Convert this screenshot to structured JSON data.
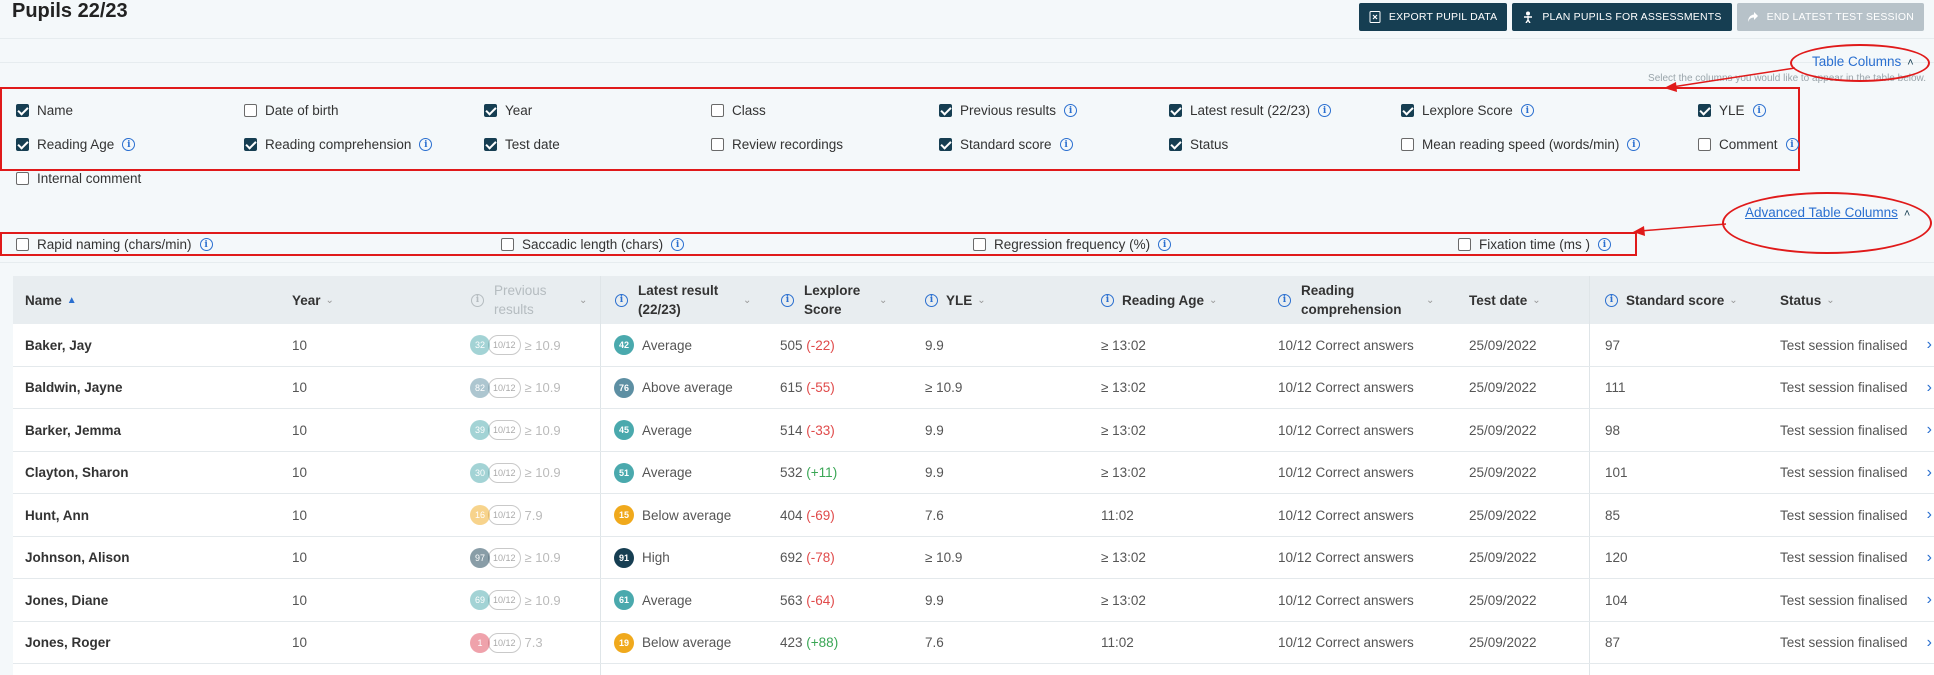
{
  "page": {
    "title": "Pupils 22/23"
  },
  "toolbar": {
    "export_label": "EXPORT PUPIL DATA",
    "plan_label": "PLAN PUPILS FOR ASSESSMENTS",
    "end_label": "END LATEST TEST SESSION"
  },
  "table_columns": {
    "link_label": "Table Columns",
    "hint": "Select the columns you would like to appear in the table below.",
    "options": [
      {
        "label": "Name",
        "checked": true,
        "info": false
      },
      {
        "label": "Date of birth",
        "checked": false,
        "info": false
      },
      {
        "label": "Year",
        "checked": true,
        "info": false
      },
      {
        "label": "Class",
        "checked": false,
        "info": false
      },
      {
        "label": "Previous results",
        "checked": true,
        "info": true
      },
      {
        "label": "Latest result (22/23)",
        "checked": true,
        "info": true
      },
      {
        "label": "Lexplore Score",
        "checked": true,
        "info": true
      },
      {
        "label": "YLE",
        "checked": true,
        "info": true
      },
      {
        "label": "Reading Age",
        "checked": true,
        "info": true
      },
      {
        "label": "Reading comprehension",
        "checked": true,
        "info": true
      },
      {
        "label": "Test date",
        "checked": true,
        "info": false
      },
      {
        "label": "Review recordings",
        "checked": false,
        "info": false
      },
      {
        "label": "Standard score",
        "checked": true,
        "info": true
      },
      {
        "label": "Status",
        "checked": true,
        "info": false
      },
      {
        "label": "Mean reading speed (words/min)",
        "checked": false,
        "info": true
      },
      {
        "label": "Comment",
        "checked": false,
        "info": true
      },
      {
        "label": "Internal comment",
        "checked": false,
        "info": false
      }
    ]
  },
  "advanced_columns": {
    "link_label": "Advanced Table Columns",
    "options": [
      {
        "label": "Rapid naming (chars/min)",
        "checked": false
      },
      {
        "label": "Saccadic length (chars)",
        "checked": false
      },
      {
        "label": "Regression frequency (%)",
        "checked": false
      },
      {
        "label": "Fixation time (ms )",
        "checked": false
      }
    ]
  },
  "table": {
    "headers": {
      "name": "Name",
      "year": "Year",
      "previous": "Previous results",
      "latest": "Latest result (22/23)",
      "lexplore": "Lexplore Score",
      "yle": "YLE",
      "reading_age": "Reading Age",
      "comprehension": "Reading comprehension",
      "test_date": "Test date",
      "standard": "Standard score",
      "status": "Status"
    },
    "rows": [
      {
        "name": "Baker, Jay",
        "year": "10",
        "prev_score": "32",
        "prev_color": "#4aa9ad",
        "prev_pill": "10/12",
        "prev_val": "≥ 10.9",
        "lat_score": "42",
        "lat_color": "#4aa9ad",
        "lat_label": "Average",
        "lex": "505",
        "lex_delta": "(-22)",
        "delta_sign": "neg",
        "yle": "9.9",
        "age": "≥ 13:02",
        "comp": "10/12 Correct answers",
        "date": "25/09/2022",
        "std": "97",
        "status": "Test session finalised"
      },
      {
        "name": "Baldwin, Jayne",
        "year": "10",
        "prev_score": "82",
        "prev_color": "#5d8fa3",
        "prev_pill": "10/12",
        "prev_val": "≥ 10.9",
        "lat_score": "76",
        "lat_color": "#5d8fa3",
        "lat_label": "Above average",
        "lex": "615",
        "lex_delta": "(-55)",
        "delta_sign": "neg",
        "yle": "≥ 10.9",
        "age": "≥ 13:02",
        "comp": "10/12 Correct answers",
        "date": "25/09/2022",
        "std": "111",
        "status": "Test session finalised"
      },
      {
        "name": "Barker, Jemma",
        "year": "10",
        "prev_score": "39",
        "prev_color": "#4aa9ad",
        "prev_pill": "10/12",
        "prev_val": "≥ 10.9",
        "lat_score": "45",
        "lat_color": "#4aa9ad",
        "lat_label": "Average",
        "lex": "514",
        "lex_delta": "(-33)",
        "delta_sign": "neg",
        "yle": "9.9",
        "age": "≥ 13:02",
        "comp": "10/12 Correct answers",
        "date": "25/09/2022",
        "std": "98",
        "status": "Test session finalised"
      },
      {
        "name": "Clayton, Sharon",
        "year": "10",
        "prev_score": "30",
        "prev_color": "#4aa9ad",
        "prev_pill": "10/12",
        "prev_val": "≥ 10.9",
        "lat_score": "51",
        "lat_color": "#4aa9ad",
        "lat_label": "Average",
        "lex": "532",
        "lex_delta": "(+11)",
        "delta_sign": "pos",
        "yle": "9.9",
        "age": "≥ 13:02",
        "comp": "10/12 Correct answers",
        "date": "25/09/2022",
        "std": "101",
        "status": "Test session finalised"
      },
      {
        "name": "Hunt, Ann",
        "year": "10",
        "prev_score": "16",
        "prev_color": "#f0a91c",
        "prev_pill": "10/12",
        "prev_val": "7.9",
        "lat_score": "15",
        "lat_color": "#f0a91c",
        "lat_label": "Below average",
        "lex": "404",
        "lex_delta": "(-69)",
        "delta_sign": "neg",
        "yle": "7.6",
        "age": "11:02",
        "comp": "10/12 Correct answers",
        "date": "25/09/2022",
        "std": "85",
        "status": "Test session finalised"
      },
      {
        "name": "Johnson, Alison",
        "year": "10",
        "prev_score": "97",
        "prev_color": "#163e52",
        "prev_pill": "10/12",
        "prev_val": "≥ 10.9",
        "lat_score": "91",
        "lat_color": "#163e52",
        "lat_label": "High",
        "lex": "692",
        "lex_delta": "(-78)",
        "delta_sign": "neg",
        "yle": "≥ 10.9",
        "age": "≥ 13:02",
        "comp": "10/12 Correct answers",
        "date": "25/09/2022",
        "std": "120",
        "status": "Test session finalised"
      },
      {
        "name": "Jones, Diane",
        "year": "10",
        "prev_score": "69",
        "prev_color": "#4aa9ad",
        "prev_pill": "10/12",
        "prev_val": "≥ 10.9",
        "lat_score": "61",
        "lat_color": "#4aa9ad",
        "lat_label": "Average",
        "lex": "563",
        "lex_delta": "(-64)",
        "delta_sign": "neg",
        "yle": "9.9",
        "age": "≥ 13:02",
        "comp": "10/12 Correct answers",
        "date": "25/09/2022",
        "std": "104",
        "status": "Test session finalised"
      },
      {
        "name": "Jones, Roger",
        "year": "10",
        "prev_score": "1",
        "prev_color": "#e0475a",
        "prev_pill": "10/12",
        "prev_val": "7.3",
        "lat_score": "19",
        "lat_color": "#f0a91c",
        "lat_label": "Below average",
        "lex": "423",
        "lex_delta": "(+88)",
        "delta_sign": "pos",
        "yle": "7.6",
        "age": "11:02",
        "comp": "10/12 Correct answers",
        "date": "25/09/2022",
        "std": "87",
        "status": "Test session finalised"
      }
    ]
  },
  "colors": {
    "primary": "#163e52",
    "link": "#2a6fd0",
    "annotation": "#e01a1a"
  }
}
